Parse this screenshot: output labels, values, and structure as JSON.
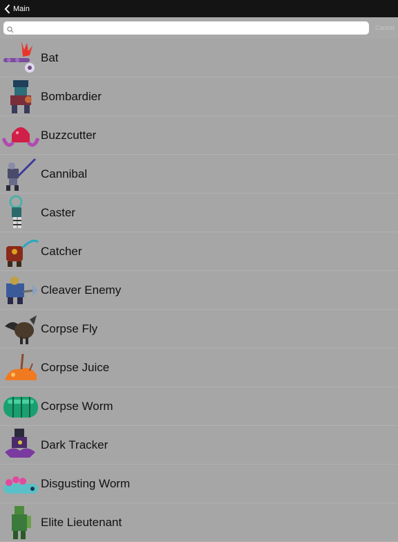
{
  "nav": {
    "back_label": "Main"
  },
  "search": {
    "placeholder": "",
    "value": "",
    "cancel_label": "Cancel"
  },
  "enemies": [
    {
      "name": "Bat",
      "icon": "bat-icon"
    },
    {
      "name": "Bombardier",
      "icon": "bombardier-icon"
    },
    {
      "name": "Buzzcutter",
      "icon": "buzzcutter-icon"
    },
    {
      "name": "Cannibal",
      "icon": "cannibal-icon"
    },
    {
      "name": "Caster",
      "icon": "caster-icon"
    },
    {
      "name": "Catcher",
      "icon": "catcher-icon"
    },
    {
      "name": "Cleaver Enemy",
      "icon": "cleaver-enemy-icon"
    },
    {
      "name": "Corpse Fly",
      "icon": "corpse-fly-icon"
    },
    {
      "name": "Corpse Juice",
      "icon": "corpse-juice-icon"
    },
    {
      "name": "Corpse Worm",
      "icon": "corpse-worm-icon"
    },
    {
      "name": "Dark Tracker",
      "icon": "dark-tracker-icon"
    },
    {
      "name": "Disgusting Worm",
      "icon": "disgusting-worm-icon"
    },
    {
      "name": "Elite Lieutenant",
      "icon": "elite-lieutenant-icon"
    }
  ],
  "colors": {
    "navbar": "#141414",
    "background": "#a6a6a6",
    "separator": "#b1b1b1",
    "cancel": "#c6c6c6"
  }
}
